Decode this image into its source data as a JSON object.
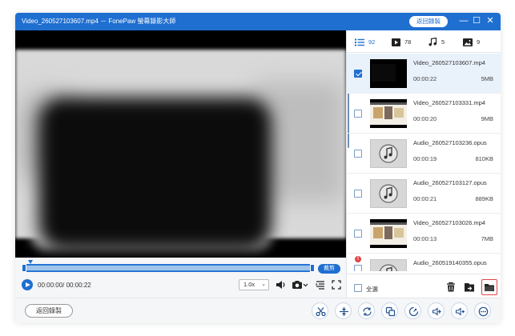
{
  "window": {
    "title": "Video_260527103607.mp4 － FonePaw 螢幕錄影大師",
    "back_to_record": "返回錄製",
    "controls": {
      "minimize": "—",
      "maximize": "☐",
      "close": "✕"
    }
  },
  "player": {
    "cut_label": "裁剪",
    "time": "00:00:00/ 00:00:22",
    "speed": "1.0x",
    "progress": 0.0
  },
  "bottom": {
    "back_label": "返回錄製",
    "tools": [
      "scissors-icon",
      "split-icon",
      "rotate-icon",
      "merge-icon",
      "compress-icon",
      "audio-convert-icon",
      "volume-up-icon",
      "more-icon"
    ]
  },
  "sidebar": {
    "tabs": [
      {
        "icon": "list-icon",
        "count": "92",
        "active": true
      },
      {
        "icon": "video-icon",
        "count": "78",
        "active": false
      },
      {
        "icon": "music-icon",
        "count": "5",
        "active": false
      },
      {
        "icon": "image-icon",
        "count": "9",
        "active": false
      }
    ],
    "items": [
      {
        "name": "Video_260527103607.mp4",
        "duration": "00:00:22",
        "size": "5MB",
        "kind": "video",
        "checked": true,
        "selected": true,
        "warning": false
      },
      {
        "name": "Video_260527103331.mp4",
        "duration": "00:00:20",
        "size": "9MB",
        "kind": "browser",
        "checked": false,
        "selected": false,
        "warning": false
      },
      {
        "name": "Audio_260527103236.opus",
        "duration": "00:00:19",
        "size": "810KB",
        "kind": "audio",
        "checked": false,
        "selected": false,
        "warning": false
      },
      {
        "name": "Audio_260527103127.opus",
        "duration": "00:00:21",
        "size": "889KB",
        "kind": "audio",
        "checked": false,
        "selected": false,
        "warning": false
      },
      {
        "name": "Video_260527103026.mp4",
        "duration": "00:00:13",
        "size": "7MB",
        "kind": "browser",
        "checked": false,
        "selected": false,
        "warning": false
      },
      {
        "name": "Audio_260519140355.opus",
        "duration": "",
        "size": "",
        "kind": "audio",
        "checked": false,
        "selected": false,
        "warning": true
      }
    ],
    "select_all": "全選",
    "accent": "#1f6fd1",
    "warning_color": "#e04646"
  }
}
